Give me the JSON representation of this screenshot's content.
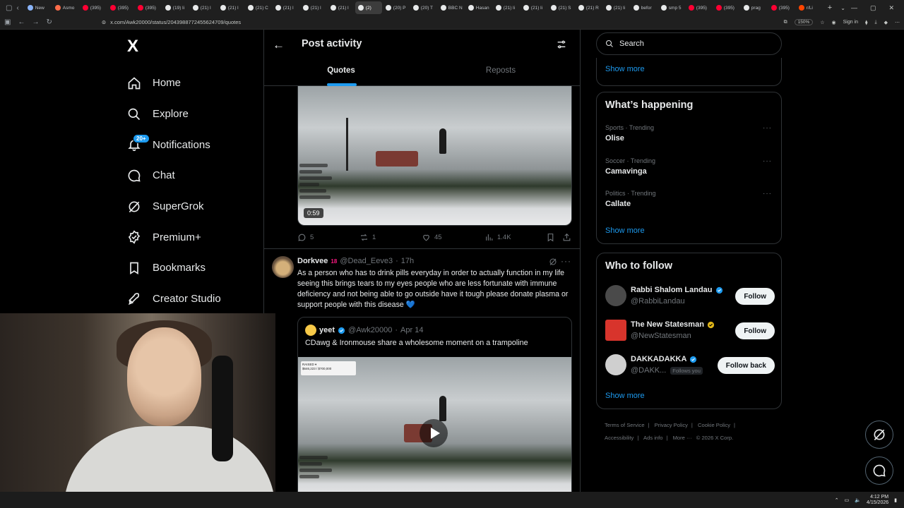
{
  "browser": {
    "tabs": [
      {
        "label": "New",
        "color": "#8ab4f8"
      },
      {
        "label": "Asmo",
        "color": "#ff6d4a"
      },
      {
        "label": "(395)",
        "color": "#ff0033"
      },
      {
        "label": "(395)",
        "color": "#ff0033"
      },
      {
        "label": "(395)",
        "color": "#ff0033"
      },
      {
        "label": "(19) li",
        "color": "#e7e9ea"
      },
      {
        "label": "(21) l",
        "color": "#e7e9ea"
      },
      {
        "label": "(21) l",
        "color": "#e7e9ea"
      },
      {
        "label": "(21) C",
        "color": "#e7e9ea"
      },
      {
        "label": "(21) l",
        "color": "#e7e9ea"
      },
      {
        "label": "(21) l",
        "color": "#e7e9ea"
      },
      {
        "label": "(21) l",
        "color": "#e7e9ea"
      },
      {
        "label": "(2)",
        "color": "#e7e9ea",
        "active": true
      },
      {
        "label": "(20) P",
        "color": "#e7e9ea"
      },
      {
        "label": "(20) T",
        "color": "#e7e9ea"
      },
      {
        "label": "BBC N",
        "color": "#e7e9ea"
      },
      {
        "label": "Hasan",
        "color": "#e7e9ea"
      },
      {
        "label": "(21) li",
        "color": "#e7e9ea"
      },
      {
        "label": "(21) li",
        "color": "#e7e9ea"
      },
      {
        "label": "(21) S",
        "color": "#e7e9ea"
      },
      {
        "label": "(21) R",
        "color": "#e7e9ea"
      },
      {
        "label": "(21) li",
        "color": "#e7e9ea"
      },
      {
        "label": "befor",
        "color": "#e7e9ea"
      },
      {
        "label": "smp 5",
        "color": "#e7e9ea"
      },
      {
        "label": "(395)",
        "color": "#ff0033"
      },
      {
        "label": "(395)",
        "color": "#ff0033"
      },
      {
        "label": "prag",
        "color": "#e7e9ea"
      },
      {
        "label": "(395)",
        "color": "#ff0033"
      },
      {
        "label": "r/Li",
        "color": "#ff4500"
      }
    ],
    "url": "x.com/Awk20000/status/2043988772455624709/quotes",
    "zoom": "150%",
    "sign_in": "Sign in"
  },
  "sidebar": {
    "logo": "X",
    "items": [
      {
        "label": "Home",
        "icon": "home-icon"
      },
      {
        "label": "Explore",
        "icon": "search-icon"
      },
      {
        "label": "Notifications",
        "icon": "bell-icon",
        "badge": "20+"
      },
      {
        "label": "Chat",
        "icon": "chat-icon"
      },
      {
        "label": "SuperGrok",
        "icon": "grok-icon"
      },
      {
        "label": "Premium+",
        "icon": "premium-icon"
      },
      {
        "label": "Bookmarks",
        "icon": "bookmark-icon"
      },
      {
        "label": "Creator Studio",
        "icon": "rocket-icon"
      }
    ]
  },
  "center": {
    "title": "Post activity",
    "tabs": {
      "quotes": "Quotes",
      "reposts": "Reposts"
    },
    "post1": {
      "duration": "0:59",
      "replies": "5",
      "reposts": "1",
      "likes": "45",
      "views": "1.4K"
    },
    "post2": {
      "name": "Dorkvee",
      "badge": "18",
      "handle": "@Dead_Eeve3",
      "time": "17h",
      "text": "As a person who has to drink pills everyday in order to actually function in my life seeing this brings tears to my eyes people who are less fortunate with immune deficiency and not being able to go outside have it tough please donate plasma or support people with this disease",
      "emoji": "💙",
      "quote": {
        "name": "yeet",
        "handle": "@Awk20000",
        "date": "Apr 14",
        "text": "CDawg & Ironmouse share a wholesome moment on a trampoline",
        "overlay_label": "RAISED ▾",
        "overlay_amount": "$646,223 / $700,000"
      }
    }
  },
  "right": {
    "search_placeholder": "Search",
    "show_more": "Show more",
    "whats_happening": {
      "title": "What’s happening",
      "trends": [
        {
          "meta": "Sports · Trending",
          "name": "Olise"
        },
        {
          "meta": "Soccer · Trending",
          "name": "Camavinga"
        },
        {
          "meta": "Politics · Trending",
          "name": "Callate"
        }
      ]
    },
    "who_to_follow": {
      "title": "Who to follow",
      "accounts": [
        {
          "name": "Rabbi Shalom Landau",
          "handle": "@RabbiLandau",
          "button": "Follow",
          "verified": "blue",
          "avatar_color": "#4a4a4a"
        },
        {
          "name": "The New Statesman",
          "handle": "@NewStatesman",
          "button": "Follow",
          "verified": "gold",
          "avatar_color": "#d8342c"
        },
        {
          "name": "DAKKADAKKA",
          "handle": "@DAKK...",
          "button": "Follow back",
          "verified": "blue",
          "follows_you": "Follows you",
          "avatar_color": "#cfcfcf"
        }
      ]
    },
    "footer": {
      "links": [
        "Terms of Service",
        "Privacy Policy",
        "Cookie Policy",
        "Accessibility",
        "Ads info",
        "More ···"
      ],
      "copyright": "© 2026 X Corp."
    }
  },
  "taskbar": {
    "time": "4:12 PM",
    "date": "4/15/2026"
  }
}
